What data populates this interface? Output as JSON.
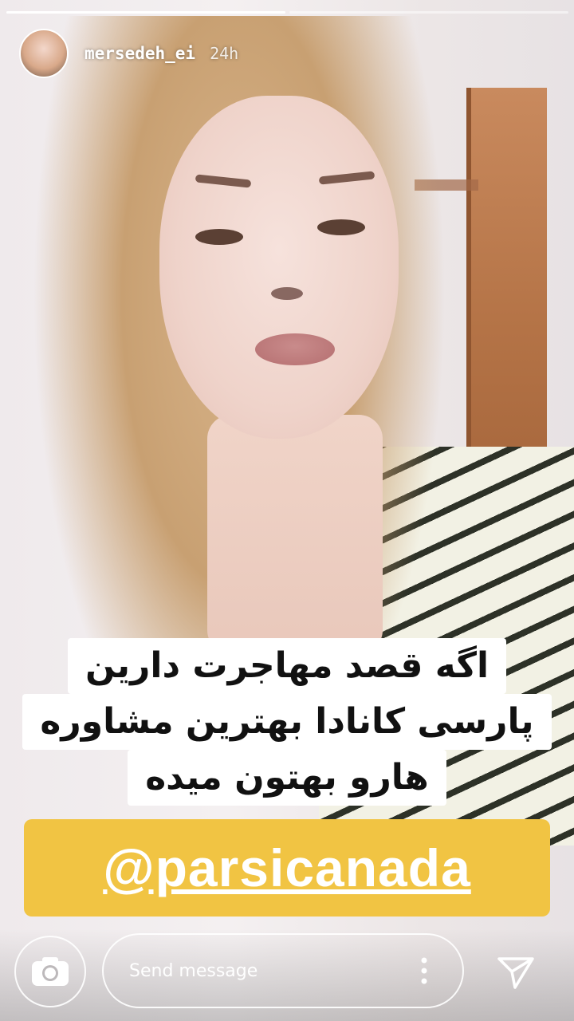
{
  "story": {
    "username": "mersedeh_ei",
    "time_ago": "24h",
    "progress": [
      1.0,
      0.0
    ],
    "caption_lines": [
      "اگه قصد مهاجرت دارین",
      "پارسی کانادا بهترین مشاوره",
      "هارو بهتون میده"
    ],
    "mention": "@parsicanada",
    "mention_color": "#f1c443"
  },
  "reply_bar": {
    "placeholder": "Send message",
    "camera_icon": "camera-icon",
    "more_icon": "more-vertical-icon",
    "send_icon": "send-icon"
  }
}
